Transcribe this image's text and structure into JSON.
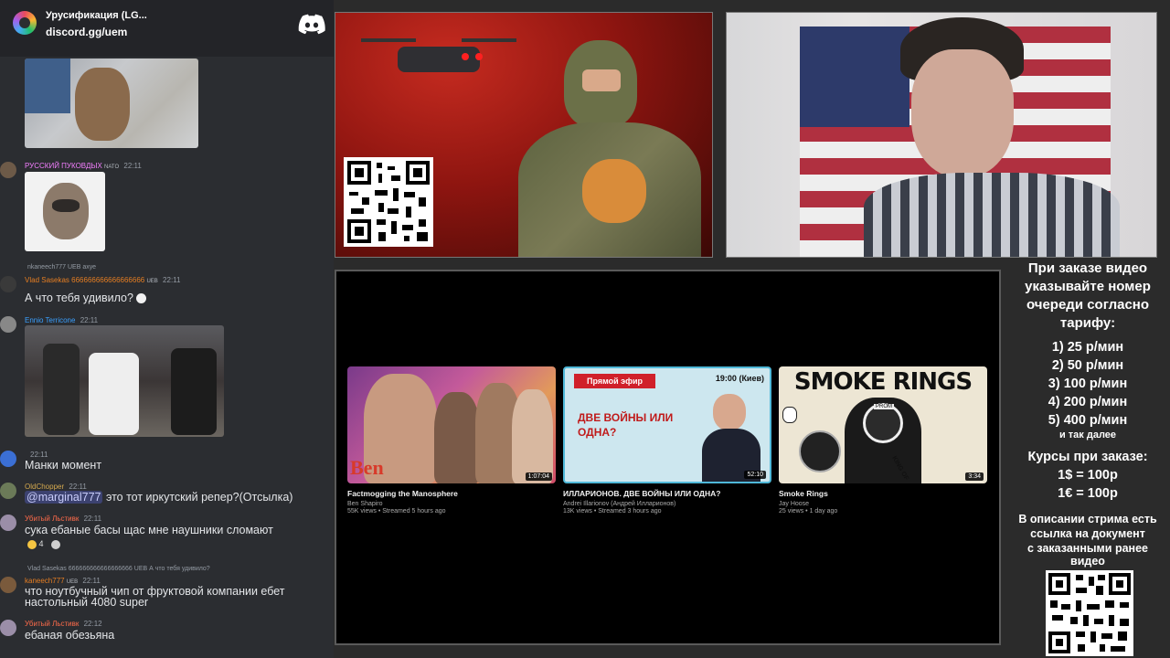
{
  "server": {
    "name": "Урусификация (LG...",
    "invite": "discord.gg/uem"
  },
  "chat": {
    "messages": [
      {
        "user": "РУССКИЙ ПУКОВДЫХ",
        "badge": "NATO",
        "time": "22:11",
        "color": "#f47fff"
      },
      {
        "reply": "nkaneech777 UEB ахуе",
        "user": "Vlad Sasekas 666666666666666666",
        "badge": "UEB",
        "time": "22:11",
        "color": "#e67e22",
        "text": "А что тебя удивило?"
      },
      {
        "user": "Ennio Terricone",
        "time": "22:11",
        "color": "#3aa0ff"
      },
      {
        "time": "22:11",
        "text": "Манки момент"
      },
      {
        "user": "OldChopper",
        "time": "22:11",
        "color": "#d4a94f",
        "mention": "@marginal777",
        "text": "это тот иркутский репер?(Отсылка)"
      },
      {
        "user": "Убитый Льстивк",
        "time": "22:11",
        "color": "#ff6b4a",
        "text": "сука ебаные басы щас мне наушники сломают",
        "reaction_count": "4"
      },
      {
        "reply": "Vlad Sasekas 666666666666666666 UEB А что тебя удивило?",
        "user": "kaneech777",
        "badge": "UEB",
        "time": "22:11",
        "color": "#e67e22",
        "text_line1": "что ноутбучный чип от фруктовой компании ебет",
        "text_line2": "настольный 4080 super"
      },
      {
        "user": "Убитый Льстивк",
        "time": "22:12",
        "color": "#ff6b4a",
        "text": "ебаная обезьяна"
      }
    ]
  },
  "videos": [
    {
      "title": "Factmogging the Manosphere",
      "channel": "Ben Shapiro",
      "meta": "55K views • Streamed 5 hours ago",
      "duration": "1:07:04",
      "thumb_text": "Ben"
    },
    {
      "title": "ИЛЛАРИОНОВ. ДВЕ ВОЙНЫ ИЛИ ОДНА?",
      "channel": "Andrei Illarionov (Андрей Илларионов)",
      "meta": "13K views • Streamed 3 hours ago",
      "duration": "52:10",
      "live_label": "Прямой эфир",
      "thumb_time": "19:00 (Киев)",
      "thumb_title": "ДВЕ ВОЙНЫ ИЛИ ОДНА?"
    },
    {
      "title": "Smoke Rings",
      "channel": "Jay Hoose",
      "meta": "25 views • 1 day ago",
      "duration": "3:34",
      "thumb_title": "SMOKE RINGS",
      "thumb_tag": "PROM",
      "thumb_tag2": "KING OF"
    }
  ],
  "info": {
    "heading_lines": [
      "При заказе видео",
      "указывайте номер",
      "очереди согласно",
      "тарифу:"
    ],
    "rates": [
      "1) 25 р/мин",
      "2) 50 р/мин",
      "3) 100 р/мин",
      "4) 200 р/мин",
      "5) 400 р/мин"
    ],
    "and_so_on": "и так далее",
    "courses_label": "Курсы при заказе:",
    "courses": [
      "1$ = 100р",
      "1€ = 100р"
    ],
    "desc_lines": [
      "В описании стрима есть",
      "ссылка на документ",
      "с заказанными ранее",
      "видео"
    ]
  },
  "icons": {
    "discord": "discord-icon",
    "server": "server-icon",
    "qr_top": "qr-code",
    "qr_bottom": "qr-code"
  },
  "colors": {
    "chat_bg": "#2b2d31",
    "header_bg": "#232428",
    "page_bg": "#2b2b2b",
    "discord_brand": "#ffffff"
  }
}
